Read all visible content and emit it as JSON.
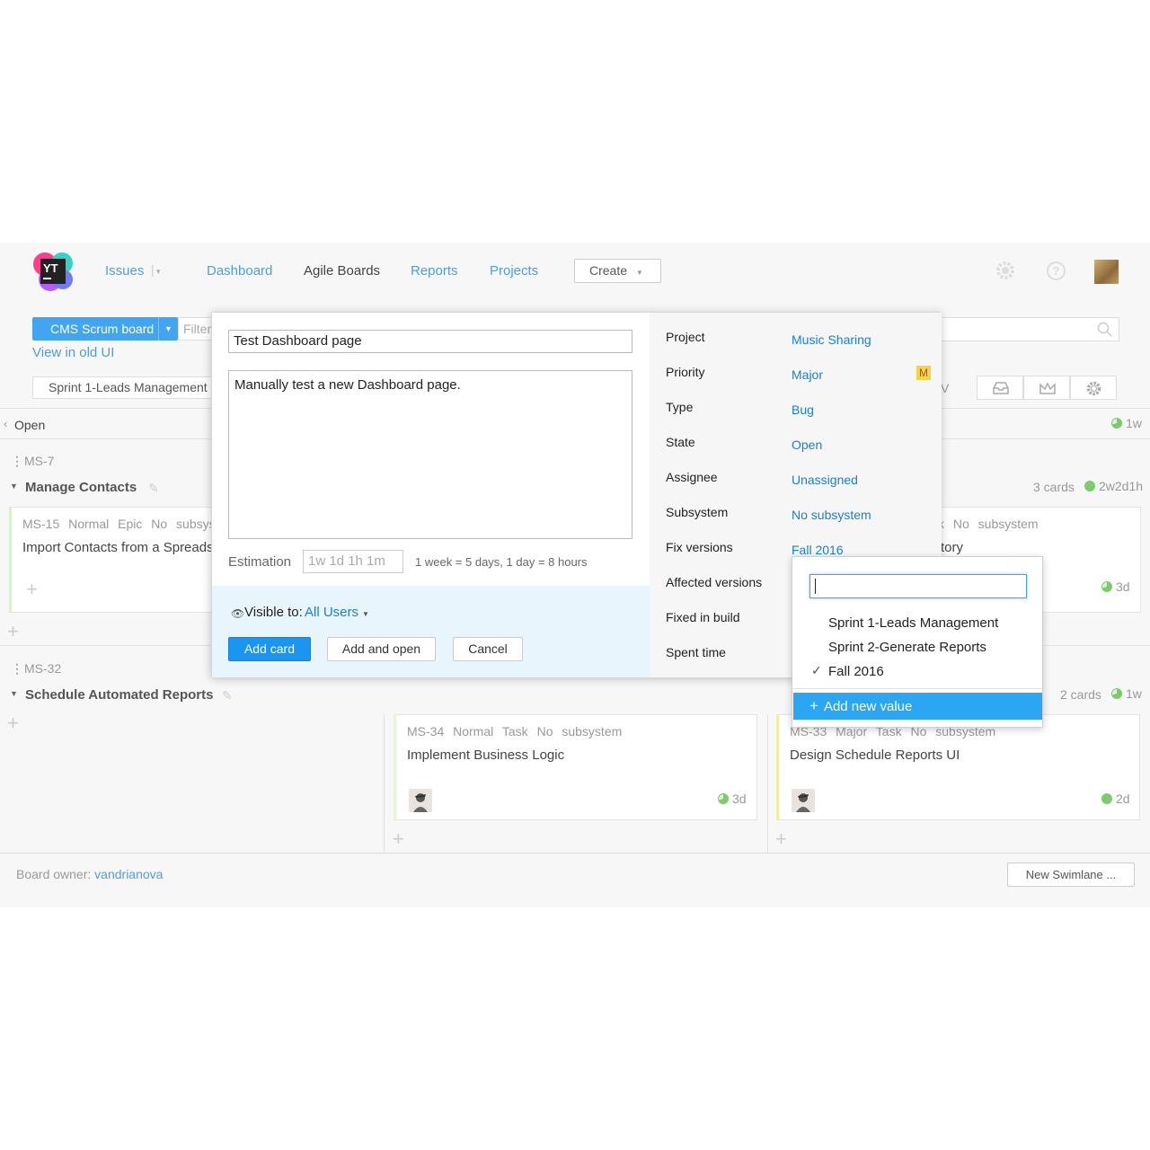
{
  "nav": {
    "issues": "Issues",
    "dashboard": "Dashboard",
    "agile_boards": "Agile Boards",
    "reports": "Reports",
    "projects": "Projects",
    "create": "Create"
  },
  "board": {
    "selector": "CMS Scrum board",
    "filter_placeholder": "Filter",
    "view_old_ui": "View in old UI",
    "sprint": "Sprint 1-Leads Management",
    "column_open": "Open",
    "column_open_estimate": "1w",
    "partial_column_label": "V"
  },
  "swimlanes": [
    {
      "id": "MS-7",
      "title": "Manage Contacts",
      "count": "3 cards",
      "estimate": "2w2d1h",
      "cards": [
        {
          "id": "MS-15",
          "priority": "Normal",
          "type": "Epic",
          "subsystem": "No subsys",
          "title": "Import Contacts from a Spreads"
        },
        {
          "partial_meta": "k No subsystem",
          "partial_title": "tory",
          "estimate": "3d"
        }
      ]
    },
    {
      "id": "MS-32",
      "title": "Schedule Automated Reports",
      "count": "2 cards",
      "estimate": "1w",
      "cards": [
        {
          "id": "MS-34",
          "priority": "Normal",
          "type": "Task",
          "subsystem": "No subsystem",
          "title": "Implement Business Logic",
          "estimate": "3d"
        },
        {
          "id": "MS-33",
          "priority": "Major",
          "type": "Task",
          "subsystem": "No subsystem",
          "title": "Design Schedule Reports UI",
          "estimate": "2d"
        }
      ]
    }
  ],
  "footer": {
    "owner_label": "Board owner:",
    "owner": "vandrianova",
    "new_swimlane": "New Swimlane ..."
  },
  "dialog": {
    "summary": "Test Dashboard page",
    "description": "Manually test a new Dashboard page.",
    "estimation_label": "Estimation",
    "estimation_placeholder": "1w 1d 1h 1m",
    "estimation_hint": "1 week = 5 days, 1 day = 8 hours",
    "visible_to_label": "Visible to:",
    "visible_to_value": "All Users",
    "add_card": "Add card",
    "add_and_open": "Add and open",
    "cancel": "Cancel",
    "fields": [
      {
        "label": "Project",
        "value": "Music Sharing"
      },
      {
        "label": "Priority",
        "value": "Major",
        "badge": "M"
      },
      {
        "label": "Type",
        "value": "Bug"
      },
      {
        "label": "State",
        "value": "Open"
      },
      {
        "label": "Assignee",
        "value": "Unassigned"
      },
      {
        "label": "Subsystem",
        "value": "No subsystem"
      },
      {
        "label": "Fix versions",
        "value": "Fall 2016"
      },
      {
        "label": "Affected versions",
        "value": ""
      },
      {
        "label": "Fixed in build",
        "value": ""
      },
      {
        "label": "Spent time",
        "value": ""
      }
    ]
  },
  "dropdown": {
    "search_value": "",
    "options": [
      {
        "label": "Sprint 1-Leads Management",
        "checked": false
      },
      {
        "label": "Sprint 2-Generate Reports",
        "checked": false
      },
      {
        "label": "Fall 2016",
        "checked": true
      }
    ],
    "add_new": "Add new value"
  },
  "colors": {
    "accent": "#1a96f0",
    "link": "#1a7fd4",
    "estimate_green": "#7dcc6b",
    "priority_badge": "#f5d34a"
  }
}
